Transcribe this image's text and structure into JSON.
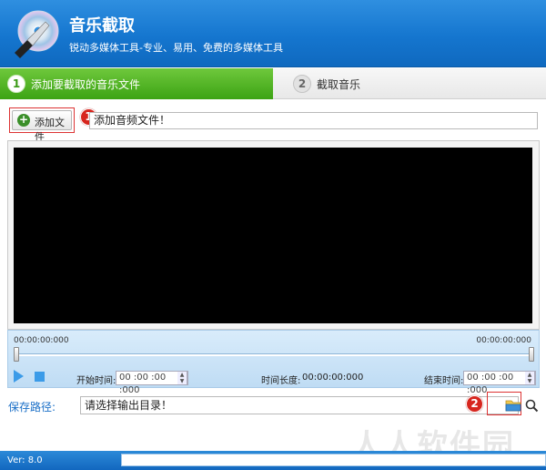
{
  "app": {
    "title": "音乐截取",
    "subtitle": "锐动多媒体工具-专业、易用、免费的多媒体工具"
  },
  "steps": [
    {
      "num": "1",
      "label": "添加要截取的音乐文件",
      "active": true
    },
    {
      "num": "2",
      "label": "截取音乐",
      "active": false
    }
  ],
  "add_file": {
    "button_label": "添加文件",
    "badge": "1",
    "field_text": "添加音频文件！"
  },
  "player": {
    "time_left": "00:00:00:000",
    "time_right": "00:00:00:000",
    "start_label": "开始时间:",
    "start_value": "00 :00 :00 :000",
    "duration_label": "时间长度:",
    "duration_value": "00:00:00:000",
    "end_label": "结束时间:",
    "end_value": "00 :00 :00 :000"
  },
  "save": {
    "label": "保存路径:",
    "field_text": "请选择输出目录！",
    "badge": "2"
  },
  "status": {
    "version": "Ver: 8.0",
    "progress": 0
  },
  "watermark": "人人软件园",
  "icons": {
    "logo": "cd-knife-icon",
    "add": "plus-circle-icon",
    "play": "play-icon",
    "stop": "stop-icon",
    "folder": "folder-icon",
    "search": "search-icon"
  },
  "colors": {
    "header_blue": "#1576cf",
    "step_green": "#3ca314",
    "badge_red": "#d7261e",
    "controls_blue": "#bfdcf4"
  }
}
